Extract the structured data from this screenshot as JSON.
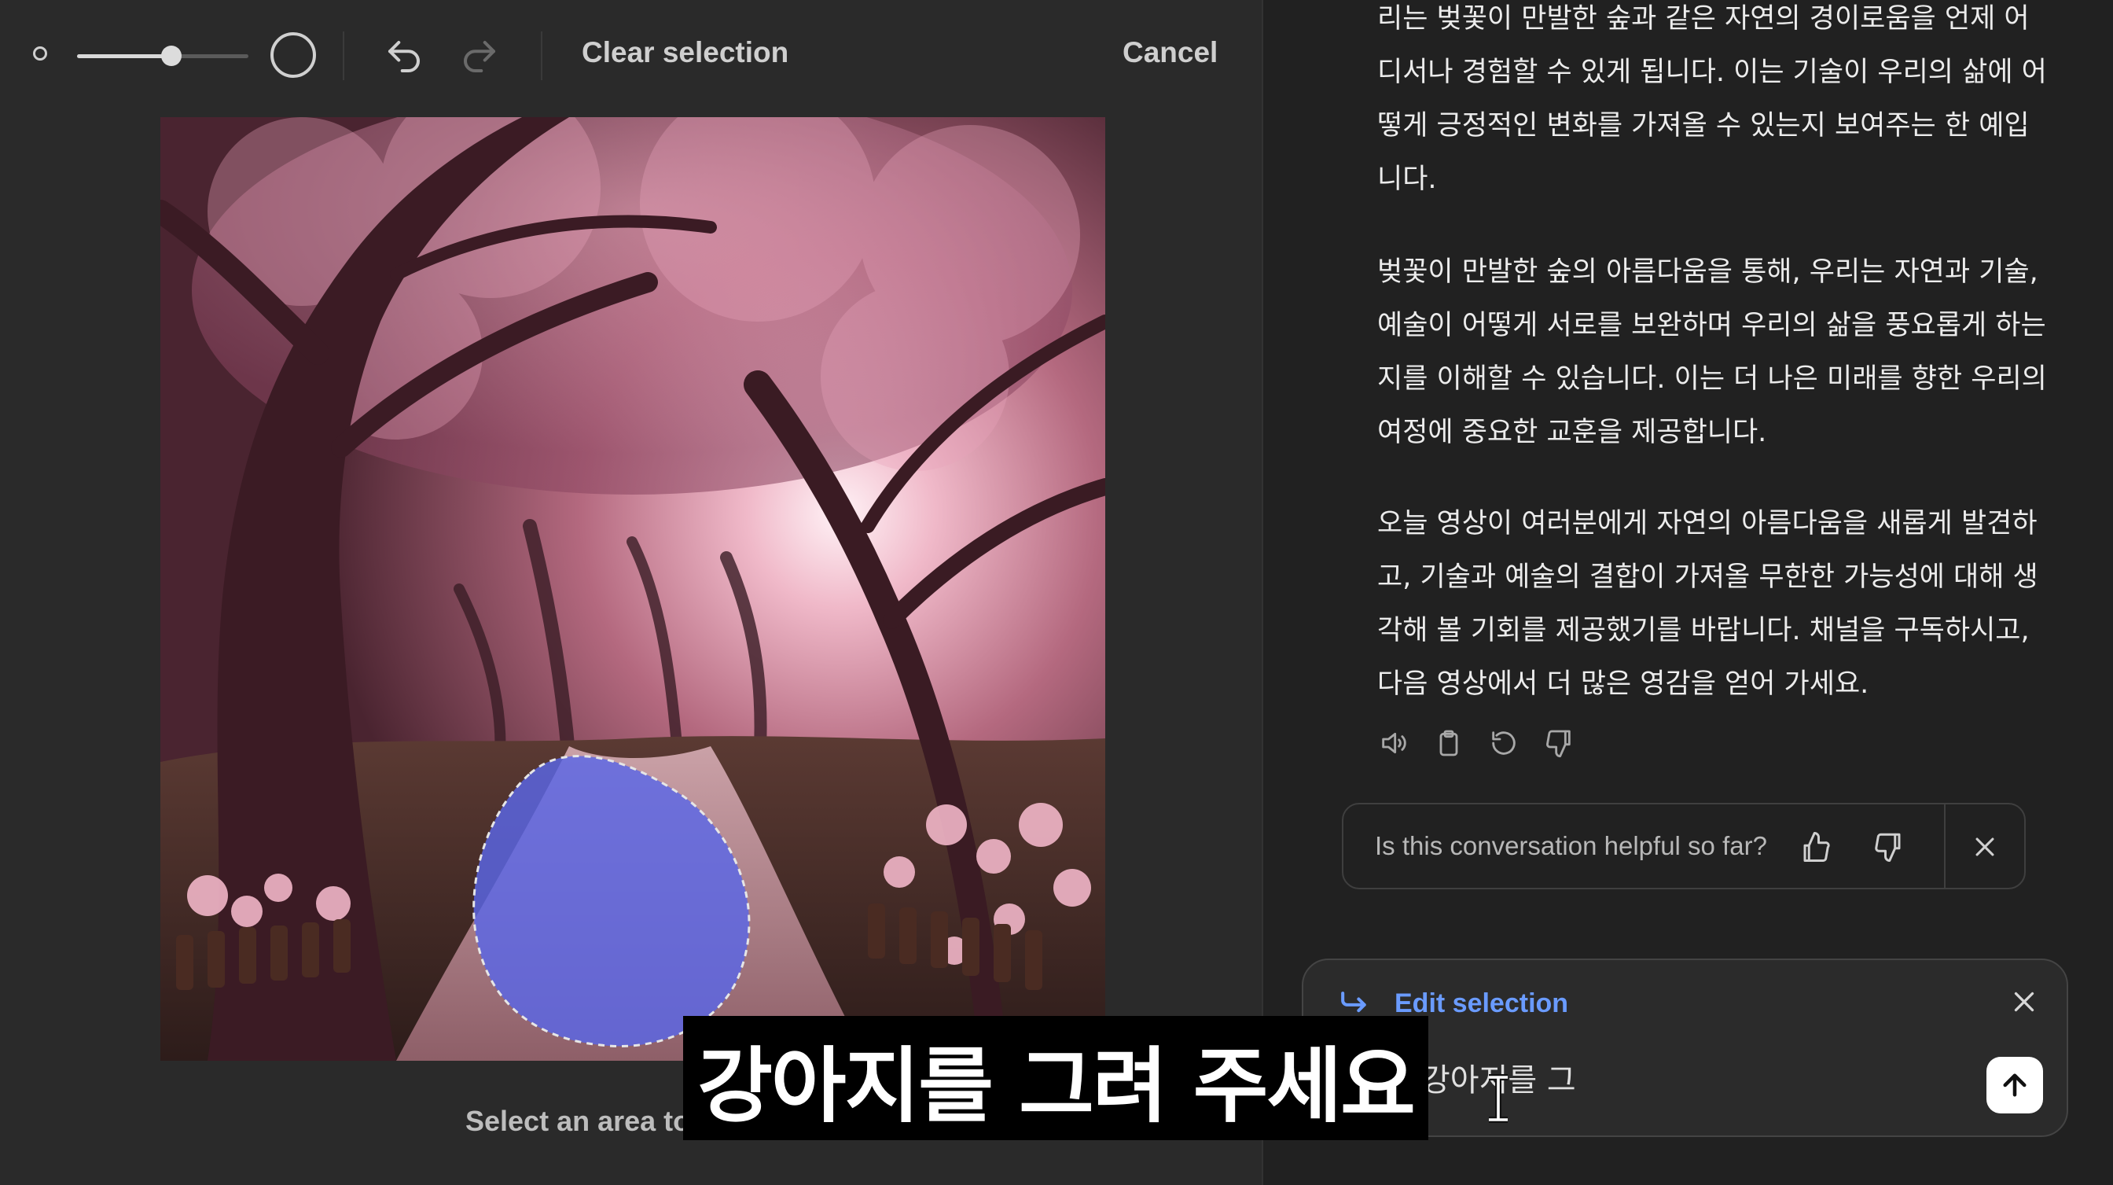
{
  "toolbar": {
    "brush_size_level": 0.55,
    "clear_selection_label": "Clear selection",
    "cancel_label": "Cancel",
    "icons": [
      "brush-small-icon",
      "brush-large-icon",
      "undo-icon",
      "redo-icon"
    ]
  },
  "editor": {
    "image_subject": "cherry blossom forest path",
    "hint_text": "Select an area to"
  },
  "chat": {
    "paragraphs": [
      {
        "lines": [
          "리는 벚꽃이 만발한 숲과 같은 자연의 경이로움을 언제 어",
          "디서나 경험할 수 있게 됩니다. 이는 기술이 우리의 삶에 어",
          "떻게 긍정적인 변화를 가져올 수 있는지 보여주는 한 예입",
          "니다."
        ]
      },
      {
        "lines": [
          "벚꽃이 만발한 숲의 아름다움을 통해, 우리는 자연과 기술,",
          "예술이 어떻게 서로를 보완하며 우리의 삶을 풍요롭게 하는",
          "지를 이해할 수 있습니다. 이는 더 나은 미래를 향한 우리의",
          "여정에 중요한 교훈을 제공합니다."
        ]
      },
      {
        "lines": [
          "오늘 영상이 여러분에게 자연의 아름다움을 새롭게 발견하",
          "고, 기술과 예술의 결합이 가져올 무한한 가능성에 대해 생",
          "각해 볼 기회를 제공했기를 바랍니다. 채널을 구독하시고,",
          "다음 영상에서 더 많은 영감을 얻어 가세요."
        ]
      }
    ],
    "message_actions": [
      "speaker-icon",
      "copy-icon",
      "regenerate-icon",
      "thumbs-down-icon"
    ],
    "feedback": {
      "question": "Is this conversation helpful so far?",
      "icons": [
        "thumbs-up-icon",
        "thumbs-down-icon",
        "close-icon"
      ]
    },
    "composer": {
      "edit_selection_label": "Edit selection",
      "input_text": "강아지를 그",
      "icons": [
        "arrow-return-icon",
        "close-icon",
        "send-arrow-up-icon"
      ]
    }
  },
  "subtitle": {
    "text": "강아지를 그려 주세요"
  },
  "colors": {
    "editor_bg": "#2a2a2a",
    "chat_bg": "#212121",
    "accent_blue": "#6a9bff",
    "selection_blue": "#5a66e6"
  }
}
